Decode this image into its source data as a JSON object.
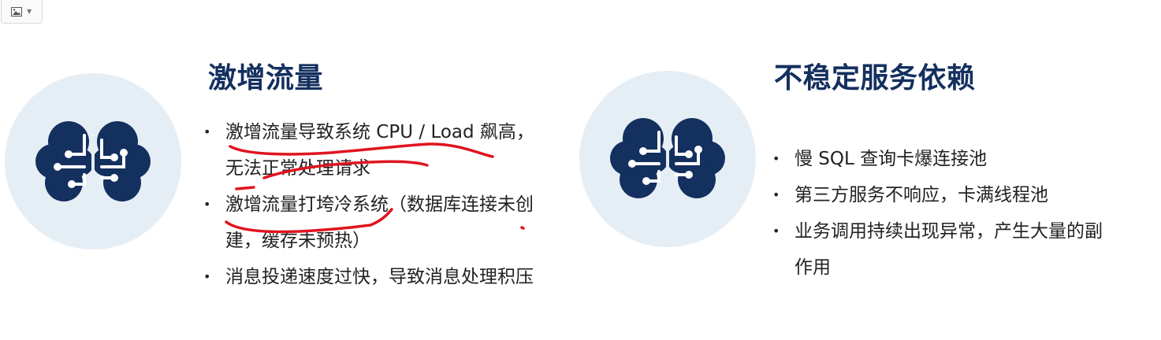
{
  "toolbar": {
    "image_icon": "image-icon",
    "caret_icon": "chevron-down-icon"
  },
  "colors": {
    "heading": "#14305f",
    "icon_fill": "#14305f",
    "circle_bg": "#e6eef5",
    "annotation": "#e0141e"
  },
  "left": {
    "icon": "brain-circuit-icon",
    "title": "激增流量",
    "bullets": [
      "激增流量导致系统 CPU / Load 飙高，无法正常处理请求",
      "激增流量打垮冷系统（数据库连接未创建，缓存未预热）",
      "消息投递速度过快，导致消息处理积压"
    ]
  },
  "right": {
    "icon": "brain-circuit-icon",
    "title": "不稳定服务依赖",
    "bullets": [
      "慢 SQL 查询卡爆连接池",
      "第三方服务不响应，卡满线程池",
      "业务调用持续出现异常，产生大量的副作用"
    ]
  }
}
